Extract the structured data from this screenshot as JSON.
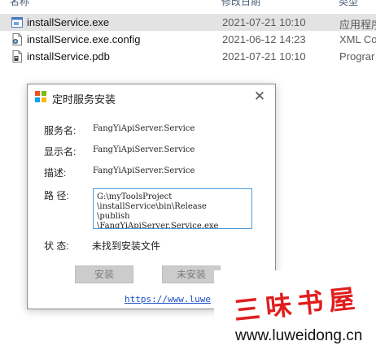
{
  "explorer": {
    "columns": {
      "name": "名称",
      "date": "修改日期",
      "type": "类型"
    },
    "files": [
      {
        "name": "installService.exe",
        "date": "2021-07-21 10:10",
        "type": "应用程序",
        "icon": "exe-file-icon",
        "selected": true
      },
      {
        "name": "installService.exe.config",
        "date": "2021-06-12 14:23",
        "type": "XML Co",
        "icon": "config-file-icon",
        "selected": false
      },
      {
        "name": "installService.pdb",
        "date": "2021-07-21 10:10",
        "type": "Prograr",
        "icon": "pdb-file-icon",
        "selected": false
      }
    ]
  },
  "dialog": {
    "title": "定时服务安装",
    "close_glyph": "✕",
    "fields": {
      "service_name": {
        "label": "服务名:",
        "value": "FangYiApiServer.Service"
      },
      "display_name": {
        "label": "显示名:",
        "value": "FangYiApiServer.Service"
      },
      "description": {
        "label": "描述:",
        "value": "FangYiApiServer.Service"
      },
      "path": {
        "label": "路 径:",
        "lines": [
          "G:\\myToolsProject",
          "\\installService\\bin\\Release",
          "\\publish",
          "\\FangYiApiServer.Service.exe"
        ]
      },
      "status": {
        "label": "状 态:",
        "value": "未找到安装文件"
      }
    },
    "buttons": {
      "install": "安装",
      "uninstall": "未安装"
    },
    "link": "https://www.luwe"
  },
  "watermark": {
    "brand": "三味书屋",
    "url": "www.luweidong.cn"
  },
  "colors": {
    "selection": "#e3e3e3",
    "link": "#1b4fc8",
    "path_border": "#4f9ad8",
    "watermark_red": "#e11d1d",
    "disabled_button": "#cccccc"
  }
}
